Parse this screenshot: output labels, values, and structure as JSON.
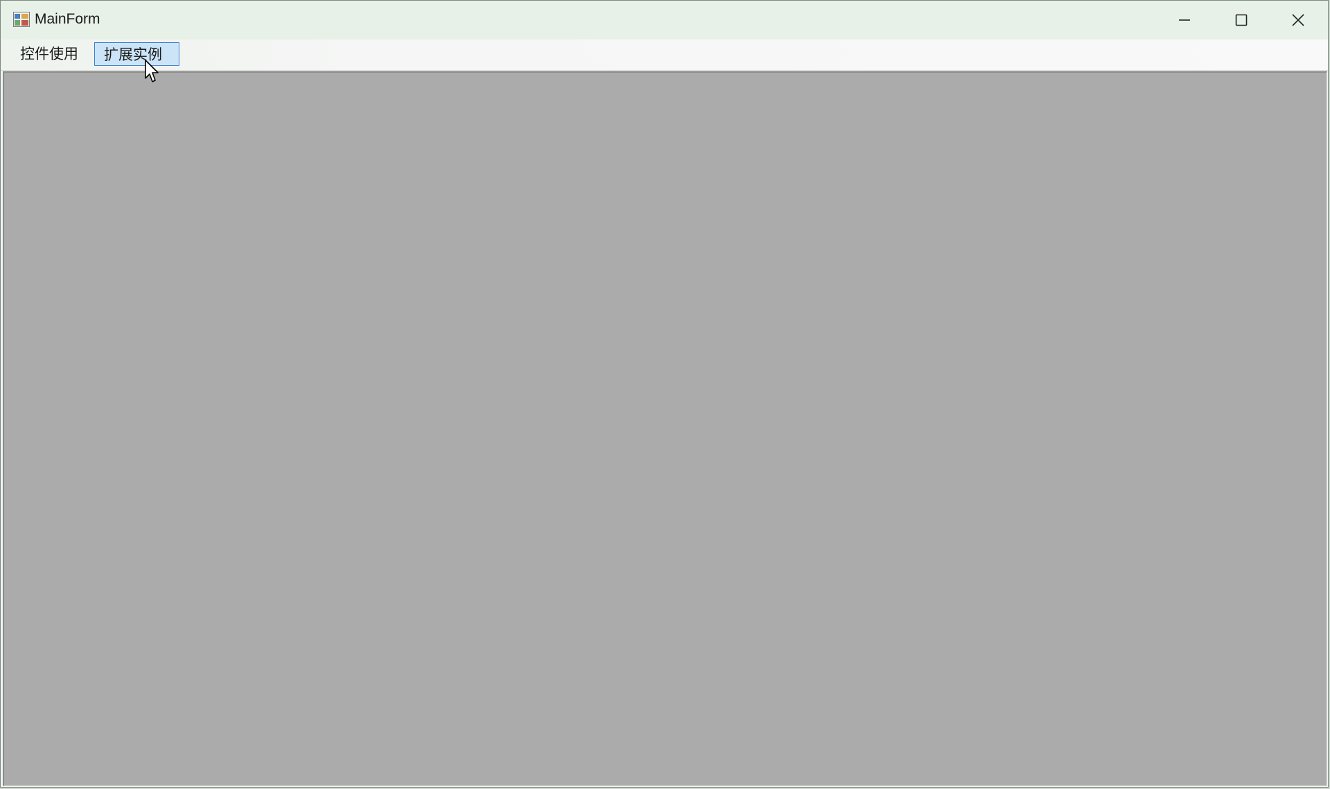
{
  "window": {
    "title": "MainForm"
  },
  "menubar": {
    "items": [
      {
        "label": "控件使用"
      },
      {
        "label": "扩展实例",
        "state": "hovered"
      }
    ]
  },
  "icons": {
    "app": "app-icon",
    "minimize": "minimize-icon",
    "maximize": "maximize-icon",
    "close": "close-icon",
    "cursor": "mouse-pointer-icon"
  },
  "colors": {
    "titlebar": "#e8f1e8",
    "mdi_background": "#ababab",
    "menu_highlight": "#cce4f7",
    "menu_highlight_border": "#3d7fd1"
  }
}
